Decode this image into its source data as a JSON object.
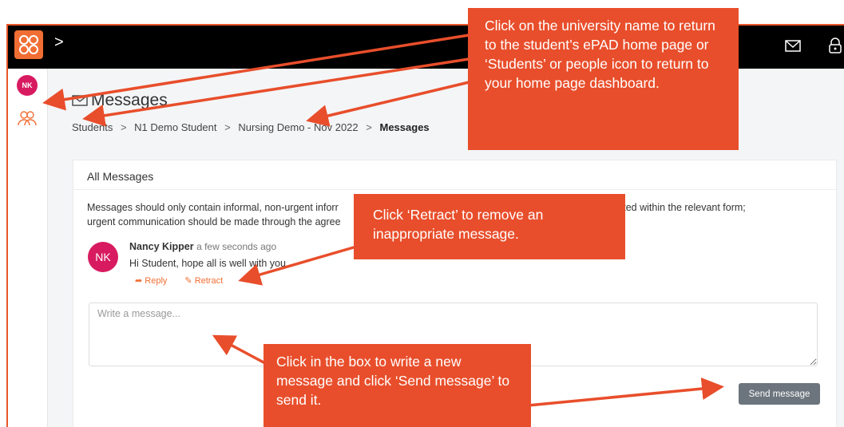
{
  "topbar": {
    "chevron": ">",
    "mail_icon": "envelope-icon",
    "lock_icon": "lock-icon"
  },
  "sidebar": {
    "avatar_initials": "NK",
    "people_icon": "people-icon"
  },
  "page": {
    "title": "Messages",
    "breadcrumb": [
      "Students",
      "N1 Demo Student",
      "Nursing Demo - Nov 2022",
      "Messages"
    ],
    "separator": ">"
  },
  "messages_card": {
    "title": "All Messages",
    "notice_line1": "Messages should only contain informal, non-urgent inforr",
    "notice_line1_end": "ocumented within the relevant form;",
    "notice_line2": "urgent communication should be made through the agree",
    "message": {
      "avatar": "NK",
      "author": "Nancy Kipper",
      "time": "a few seconds ago",
      "body": "Hi Student, hope all is well with you"
    },
    "reply_label": "Reply",
    "retract_label": "Retract",
    "compose_placeholder": "Write a message...",
    "send_label": "Send message"
  },
  "callouts": {
    "top": "Click on the university name to return to the student’s ePAD home page or ‘Students’ or people icon to return to your home page dashboard.",
    "retract": "Click ‘Retract’ to remove an inappropriate message.",
    "compose": "Click in the box to write a new message and click ‘Send message’ to send it."
  },
  "colors": {
    "accent": "#f06e34",
    "callout": "#e84e2b",
    "avatar": "#d81b60",
    "topbar": "#000000"
  }
}
